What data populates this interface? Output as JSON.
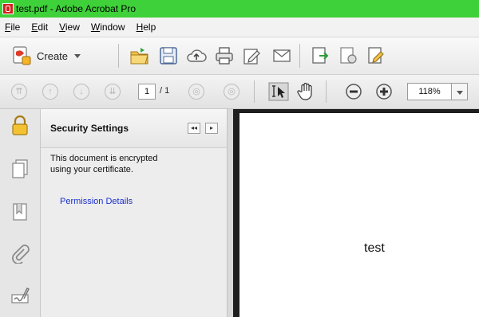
{
  "window": {
    "title": "test.pdf - Adobe Acrobat Pro"
  },
  "menu": [
    {
      "mnemonic": "F",
      "rest": "ile"
    },
    {
      "mnemonic": "E",
      "rest": "dit"
    },
    {
      "mnemonic": "V",
      "rest": "iew"
    },
    {
      "mnemonic": "W",
      "rest": "indow"
    },
    {
      "mnemonic": "H",
      "rest": "elp"
    }
  ],
  "toolbar": {
    "create_label": "Create"
  },
  "navigation": {
    "page_current": "1",
    "page_total": "/ 1",
    "zoom": "118%"
  },
  "security_panel": {
    "title": "Security Settings",
    "collapse_label": "◂◂",
    "expand_label": "▸",
    "line1": "This document is encrypted",
    "line2": "using your certificate.",
    "link_label": "Permission Details"
  },
  "document": {
    "text": "test"
  },
  "colors": {
    "titlebar": "#3fd13a",
    "link": "#1a2fd0",
    "doc_bg": "#1e1e1e"
  }
}
